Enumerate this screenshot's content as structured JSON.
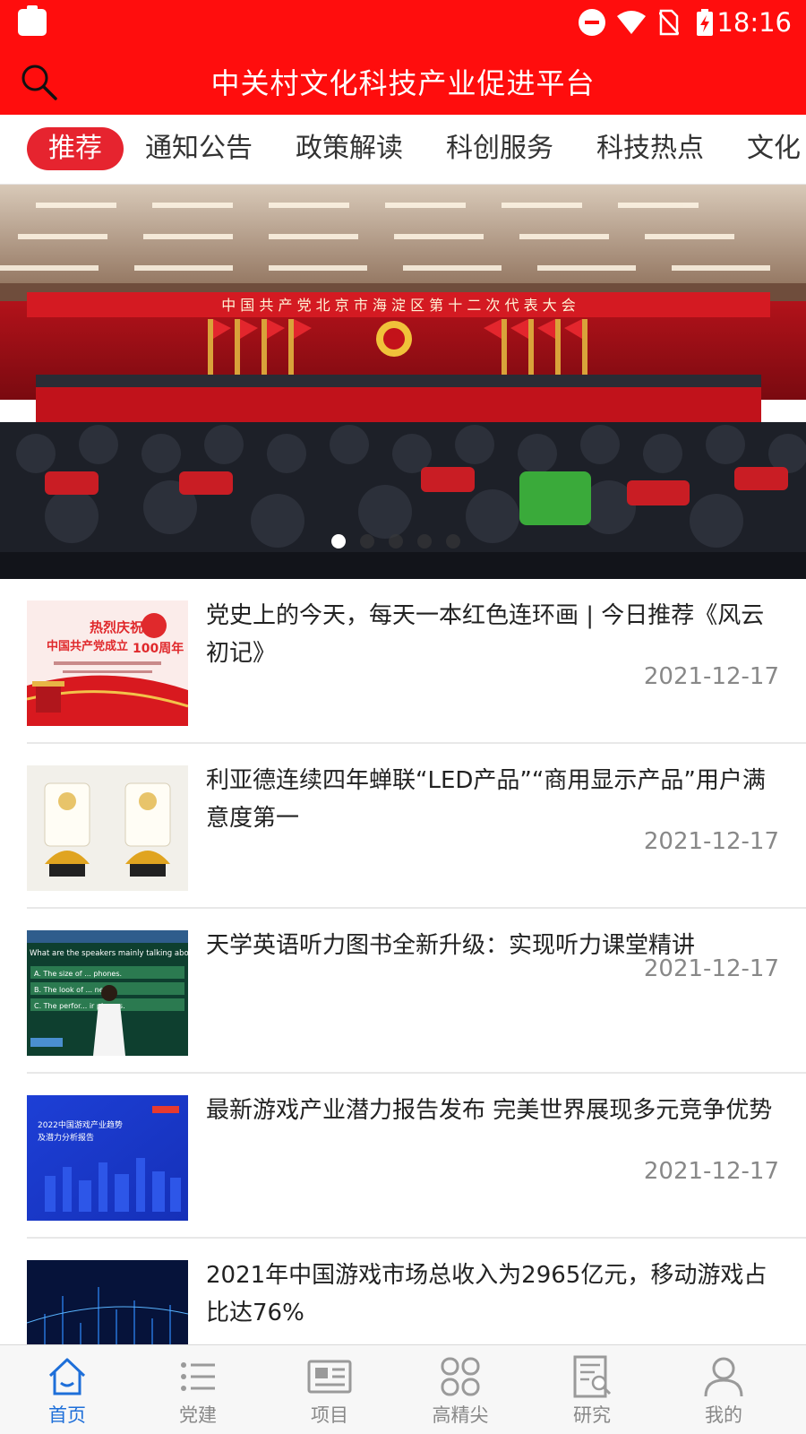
{
  "status_bar": {
    "time": "18:16"
  },
  "header": {
    "title": "中关村文化科技产业促进平台",
    "accent_color": "#ff0d0d"
  },
  "tabs": [
    {
      "label": "推荐",
      "active": true
    },
    {
      "label": "通知公告",
      "active": false
    },
    {
      "label": "政策解读",
      "active": false
    },
    {
      "label": "科创服务",
      "active": false
    },
    {
      "label": "科技热点",
      "active": false
    },
    {
      "label": "文化"
    }
  ],
  "banner": {
    "banner_text": "中 国 共 产 党 北 京 市 海 淀 区 第 十 二 次 代 表 大 会",
    "dot_count": 5,
    "active_dot": 1
  },
  "news": [
    {
      "title": "党史上的今天，每天一本红色连环画 | 今日推荐《风云初记》",
      "date": "2021-12-17",
      "thumb": {
        "line1": "热烈庆祝",
        "line2": "中国共产党成立",
        "line3": "100周年"
      }
    },
    {
      "title": "利亚德连续四年蝉联“LED产品”“商用显示产品”用户满意度第一",
      "date": "2021-12-17",
      "thumb": {}
    },
    {
      "title": "天学英语听力图书全新升级：实现听力课堂精讲",
      "date": "2021-12-17",
      "thumb": {
        "question": "What are the speakers mainly talking about?",
        "opt_a": "A. The size of ... phones.",
        "opt_b": "B. The look of ... nes.",
        "opt_c": "C. The perfor... ir phones."
      }
    },
    {
      "title": "最新游戏产业潜力报告发布 完美世界展现多元竞争优势",
      "date": "2021-12-17",
      "thumb": {
        "line1": "2022中国游戏产业趋势",
        "line2": "及潜力分析报告"
      }
    },
    {
      "title": "2021年中国游戏市场总收入为2965亿元，移动游戏占比达76%",
      "date": "",
      "thumb": {}
    }
  ],
  "bottom_nav": [
    {
      "label": "首页",
      "icon": "home-icon",
      "active": true
    },
    {
      "label": "党建",
      "icon": "list-icon",
      "active": false
    },
    {
      "label": "项目",
      "icon": "newspaper-icon",
      "active": false
    },
    {
      "label": "高精尖",
      "icon": "grid-icon",
      "active": false
    },
    {
      "label": "研究",
      "icon": "research-icon",
      "active": false
    },
    {
      "label": "我的",
      "icon": "user-icon",
      "active": false
    }
  ],
  "colors": {
    "nav_active": "#1e6fd9",
    "tab_active_bg": "#e6242f"
  }
}
